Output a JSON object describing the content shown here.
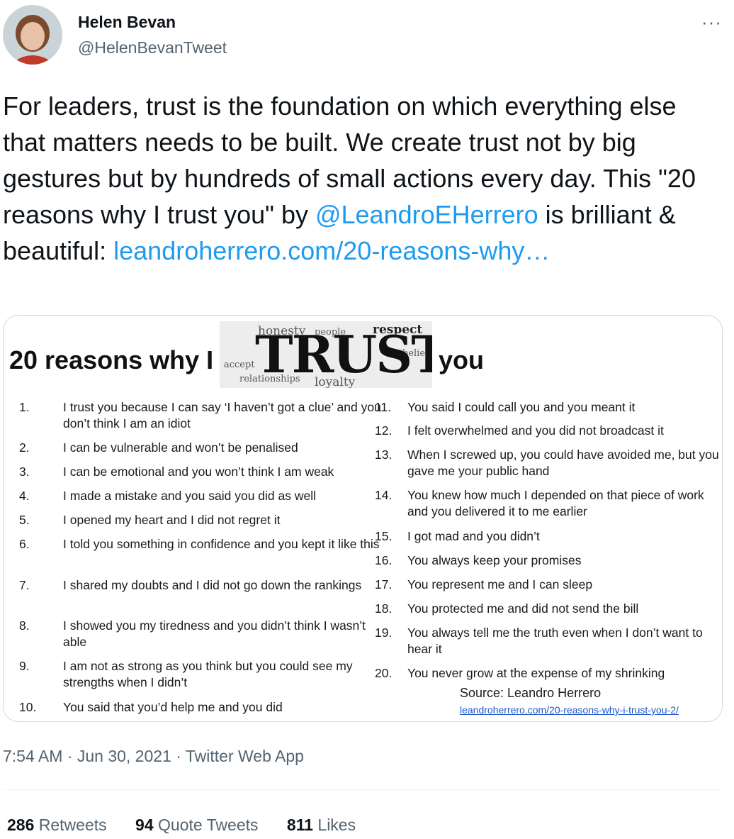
{
  "author": {
    "name": "Helen Bevan",
    "handle": "@HelenBevanTweet"
  },
  "more_icon": "more-horizontal-icon",
  "tweet": {
    "text_1": "For leaders, trust is the foundation on which everything else that matters needs to be built. We create trust not by big gestures but by hundreds of small actions every day. This \"20 reasons why I trust you\" by ",
    "mention": "@LeandroEHerrero",
    "text_2": " is brilliant & beautiful: ",
    "link": "leandroherrero.com/20-reasons-why…"
  },
  "image": {
    "title_a": "20 reasons why I",
    "title_b": "you",
    "trust_word": "TRUST",
    "word_cloud": [
      "honesty",
      "people",
      "respect",
      "accept",
      "belief",
      "relationships",
      "loyalty"
    ],
    "reasons_col1": [
      {
        "n": "1.",
        "t": "I trust you because I can say ‘I haven’t got a clue’ and you don’t think I am an idiot"
      },
      {
        "n": "2.",
        "t": "I can be vulnerable and won’t be penalised"
      },
      {
        "n": "3.",
        "t": "I can be emotional and you won’t think I am weak"
      },
      {
        "n": "4.",
        "t": "I made a mistake and you said you did as well"
      },
      {
        "n": "5.",
        "t": "I opened my heart and I did not regret it"
      },
      {
        "n": "6.",
        "t": "I told you something in confidence and you kept it like this"
      },
      {
        "n": "7.",
        "t": "I shared my doubts and I did not go down the rankings"
      },
      {
        "n": "8.",
        "t": "I showed you my tiredness and you didn’t think I wasn’t able"
      },
      {
        "n": "9.",
        "t": "I am not as strong as you think but you could see my strengths when I didn’t"
      },
      {
        "n": "10.",
        "t": "You said that you’d help me and you did"
      }
    ],
    "reasons_col2": [
      {
        "n": "11.",
        "t": "You said I could call you and you meant it"
      },
      {
        "n": "12.",
        "t": "I felt overwhelmed and you did not broadcast it"
      },
      {
        "n": "13.",
        "t": "When I screwed up, you could have avoided me, but you gave me your public hand"
      },
      {
        "n": "14.",
        "t": "You knew how much I depended on that piece of work and you delivered it to me earlier"
      },
      {
        "n": "15.",
        "t": "I got mad and you didn’t"
      },
      {
        "n": "16.",
        "t": "You always keep your promises"
      },
      {
        "n": "17.",
        "t": "You represent me and I can sleep"
      },
      {
        "n": "18.",
        "t": "You protected me and did not send the bill"
      },
      {
        "n": "19.",
        "t": "You always tell me the truth even when I don’t want to hear it"
      },
      {
        "n": "20.",
        "t": "You never grow at the expense of my shrinking"
      }
    ],
    "source": "Source: Leandro Herrero",
    "source_link": "leandroherrero.com/20-reasons-why-i-trust-you-2/"
  },
  "meta": {
    "time": "7:54 AM",
    "sep": " · ",
    "date": "Jun 30, 2021",
    "app": "Twitter Web App"
  },
  "stats": {
    "retweets_count": "286",
    "retweets_label": "Retweets",
    "quotes_count": "94",
    "quotes_label": "Quote Tweets",
    "likes_count": "811",
    "likes_label": "Likes"
  }
}
